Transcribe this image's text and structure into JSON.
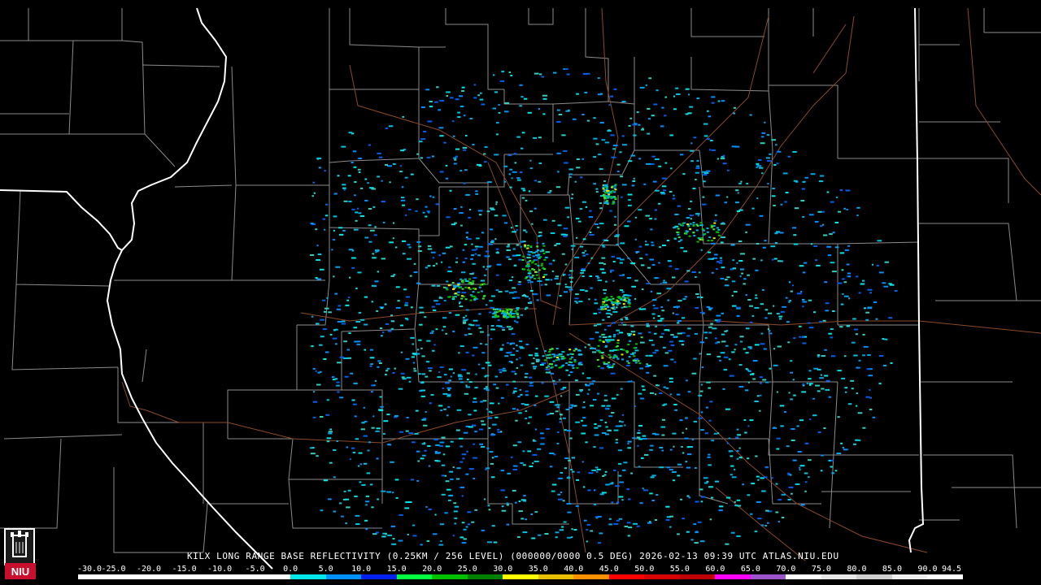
{
  "product": {
    "caption": "KILX LONG RANGE BASE REFLECTIVITY (0.25KM / 256 LEVEL) (000000/0000 0.5 DEG) 2026-02-13 09:39 UTC  ATLAS.NIU.EDU",
    "radar_site": "KILX",
    "source": "ATLAS.NIU.EDU",
    "valid_time": "2026-02-13 09:39 UTC",
    "elevation": "0.5 DEG"
  },
  "logo": {
    "text": "NIU",
    "color": "#c8102e"
  },
  "colors": {
    "background": "#000000",
    "county_lines": "#8a8a8a",
    "state_lines": "#ffffff",
    "highways": "#8b4a2b"
  },
  "scale": {
    "labels": [
      "-30.0",
      "-25.0",
      "-20.0",
      "-15.0",
      "-10.0",
      "-5.0",
      "0.0",
      "5.0",
      "10.0",
      "15.0",
      "20.0",
      "25.0",
      "30.0",
      "35.0",
      "40.0",
      "45.0",
      "50.0",
      "55.0",
      "60.0",
      "65.0",
      "70.0",
      "75.0",
      "80.0",
      "85.0",
      "90.0",
      "94.5"
    ],
    "colors": [
      "#ffffff",
      "#ffffff",
      "#ffffff",
      "#ffffff",
      "#ffffff",
      "#ffffff",
      "#00e8e8",
      "#0090ff",
      "#0020f0",
      "#00ff40",
      "#00c000",
      "#008000",
      "#ffff00",
      "#e8c000",
      "#ff9000",
      "#ff0000",
      "#d60000",
      "#c00000",
      "#ff00ff",
      "#9955c9",
      "#ffffff",
      "#e8e8e8",
      "#d0d0d0",
      "#f0f0f0",
      "#ffffff"
    ]
  }
}
